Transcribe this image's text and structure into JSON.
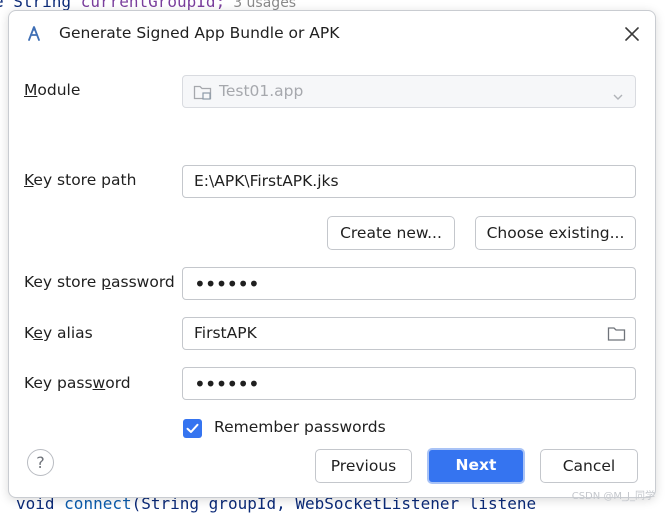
{
  "background_code": {
    "top_line_prefix": "e String ",
    "top_line_fn": "currentGroupId;",
    "top_line_usages": "3 usages",
    "bottom_line_prefix": "void ",
    "bottom_line_fn": "connect",
    "bottom_line_rest": "(String groupId, WebSocketListener listene"
  },
  "dialog": {
    "title": "Generate Signed App Bundle or APK",
    "module": {
      "label": "Module",
      "value": "Test01.app"
    },
    "key_store_path": {
      "label": "Key store path",
      "value": "E:\\APK\\FirstAPK.jks"
    },
    "buttons": {
      "create_new": "Create new...",
      "choose_existing": "Choose existing..."
    },
    "key_store_password": {
      "label": "Key store password",
      "masked": "••••••"
    },
    "key_alias": {
      "label": "Key alias",
      "value": "FirstAPK"
    },
    "key_password": {
      "label": "Key password",
      "masked": "••••••"
    },
    "remember_passwords": {
      "label": "Remember passwords",
      "checked": true
    },
    "help_label": "?",
    "footer": {
      "previous": "Previous",
      "next": "Next",
      "cancel": "Cancel"
    }
  },
  "watermark": "CSDN @M_J_同学",
  "colors": {
    "accent": "#3574f0",
    "border": "#c4c7cc"
  },
  "icons": [
    "android-studio-icon",
    "close-icon",
    "module-folder-icon",
    "chevron-down-icon",
    "folder-icon",
    "checkmark-icon",
    "help-icon"
  ]
}
